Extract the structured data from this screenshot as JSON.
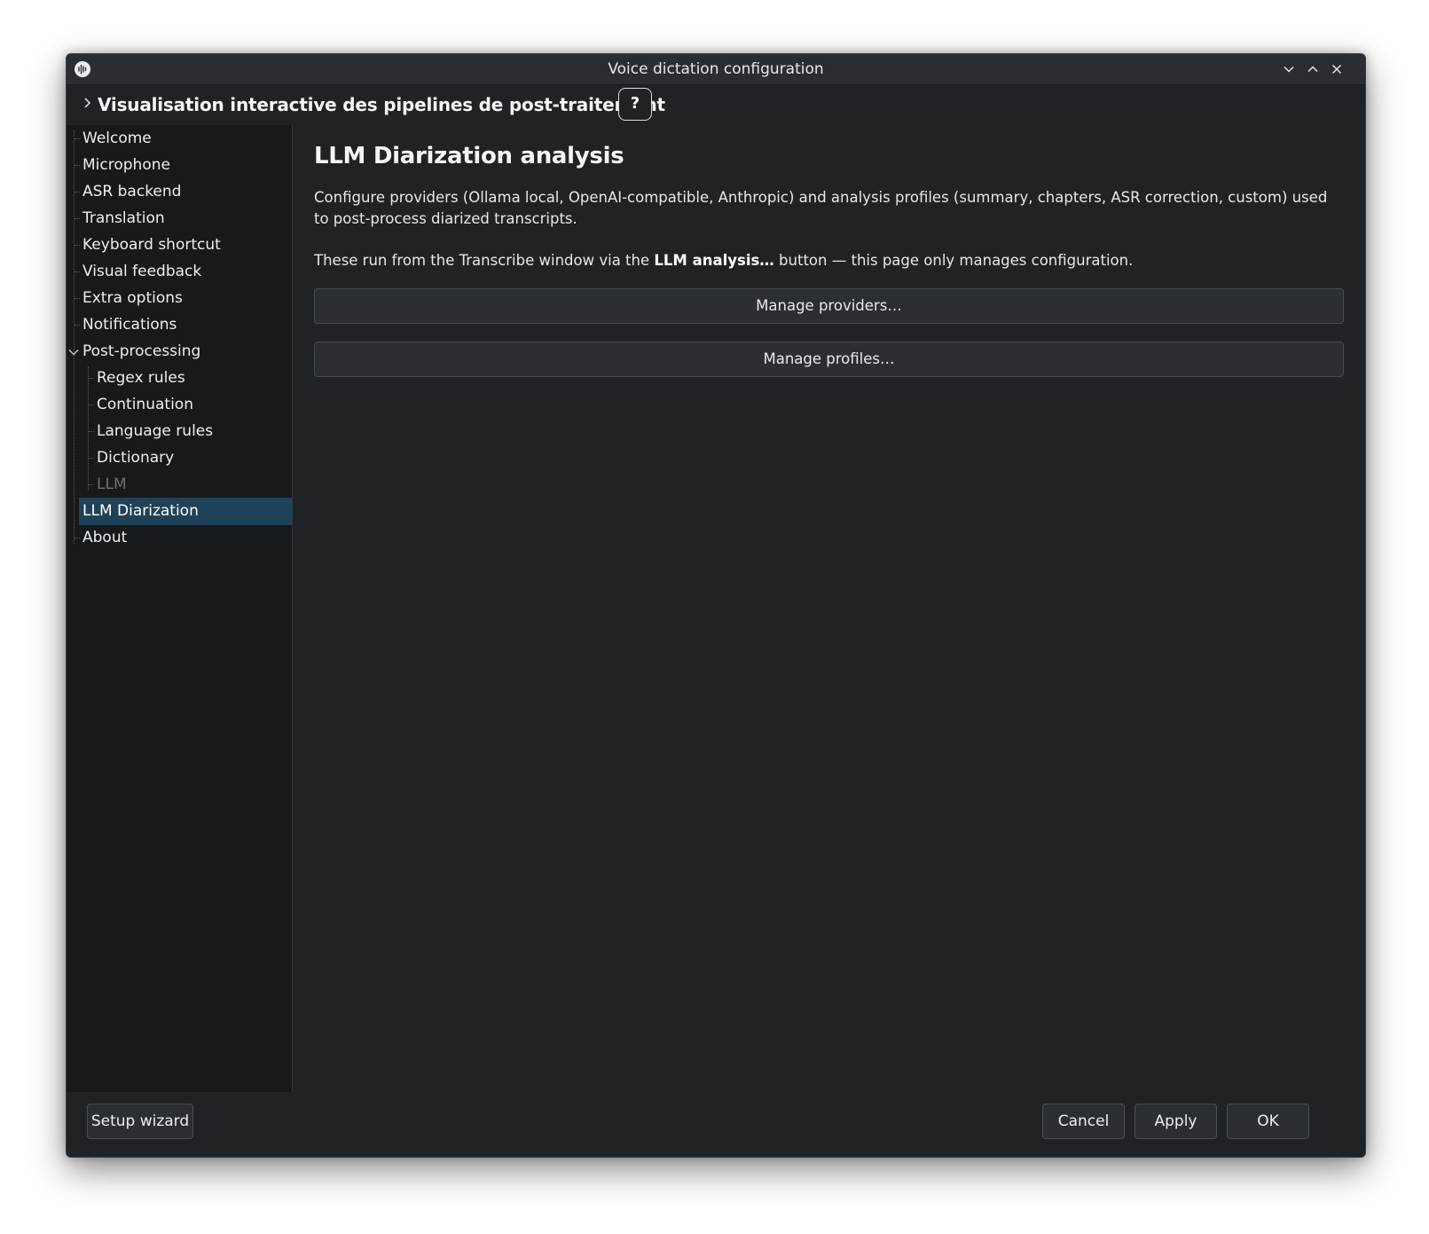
{
  "window": {
    "title": "Voice dictation configuration"
  },
  "header": {
    "title": "Visualisation interactive des pipelines de post-traitement",
    "help_label": "?"
  },
  "sidebar": {
    "items": [
      {
        "label": "Welcome"
      },
      {
        "label": "Microphone"
      },
      {
        "label": "ASR backend"
      },
      {
        "label": "Translation"
      },
      {
        "label": "Keyboard shortcut"
      },
      {
        "label": "Visual feedback"
      },
      {
        "label": "Extra options"
      },
      {
        "label": "Notifications"
      },
      {
        "label": "Post-processing",
        "expanded": true
      },
      {
        "label": "Regex rules"
      },
      {
        "label": "Continuation"
      },
      {
        "label": "Language rules"
      },
      {
        "label": "Dictionary"
      },
      {
        "label": "LLM",
        "disabled": true
      },
      {
        "label": "LLM Diarization",
        "selected": true
      },
      {
        "label": "About"
      }
    ]
  },
  "main": {
    "heading": "LLM Diarization analysis",
    "description": "Configure providers (Ollama local, OpenAI-compatible, Anthropic) and analysis profiles (summary, chapters, ASR correction, custom) used to post-process diarized transcripts.",
    "note_prefix": "These run from the Transcribe window via the ",
    "note_bold": "LLM analysis…",
    "note_suffix": " button — this page only manages configuration.",
    "manage_providers_label": "Manage providers…",
    "manage_profiles_label": "Manage profiles…"
  },
  "footer": {
    "setup_wizard_label": "Setup wizard",
    "cancel_label": "Cancel",
    "apply_label": "Apply",
    "ok_label": "OK"
  },
  "colors": {
    "window_bg": "#202326",
    "sidebar_bg": "#17191b",
    "selection": "#1e4258",
    "button_bg": "#2b2f33"
  }
}
